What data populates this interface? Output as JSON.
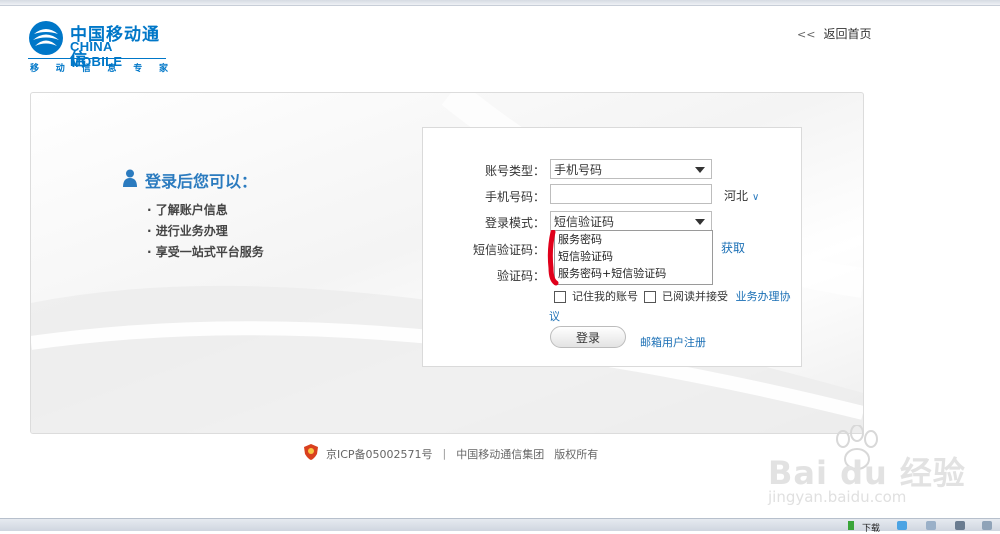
{
  "header": {
    "logo_cn": "中国移动通信",
    "logo_en": "CHINA MOBILE",
    "slogan": [
      "移",
      "动",
      "信",
      "息",
      "专",
      "家"
    ],
    "back_chevron": "<<",
    "back_label": "返回首页"
  },
  "benefits": {
    "title": "登录后您可以：",
    "items": [
      "· 了解账户信息",
      "· 进行业务办理",
      "· 享受一站式平台服务"
    ]
  },
  "form": {
    "account_type_label": "账号类型：",
    "account_type_value": "手机号码",
    "phone_label": "手机号码：",
    "phone_value": "",
    "region_label": "河北",
    "login_mode_label": "登录模式：",
    "login_mode_value": "短信验证码",
    "login_mode_options": [
      "服务密码",
      "短信验证码",
      "服务密码+短信验证码"
    ],
    "sms_code_label": "短信验证码：",
    "get_code_link": "获取",
    "captcha_label": "验证码：",
    "remember_label": "记住我的账号",
    "agree_label": "已阅读并接受",
    "agreement_link_part1": "业务办理协",
    "agreement_link_part2": "议",
    "login_button": "登录",
    "register_link": "邮箱用户注册"
  },
  "footer": {
    "icp": "京ICP备05002571号",
    "separator": "|",
    "company": "中国移动通信集团",
    "rights": "版权所有"
  },
  "watermark": {
    "brand": "Bai du 经验",
    "url": "jingyan.baidu.com"
  },
  "taskbar": {
    "download": "下载"
  },
  "colors": {
    "brand_blue": "#0077c8",
    "link_blue": "#1a6fb5",
    "annotation_red": "#e0001b"
  }
}
